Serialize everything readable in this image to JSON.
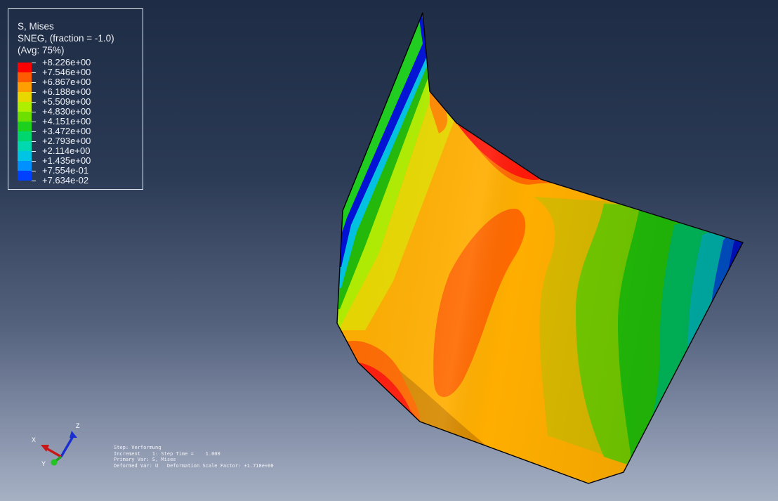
{
  "legend": {
    "title": "S, Mises",
    "subtitle": "SNEG, (fraction = -1.0)",
    "averaging": "(Avg: 75%)",
    "levels": [
      {
        "value": "+8.226e+00",
        "color": "#ff0000"
      },
      {
        "value": "+7.546e+00",
        "color": "#ff5a00"
      },
      {
        "value": "+6.867e+00",
        "color": "#ff9e00"
      },
      {
        "value": "+6.188e+00",
        "color": "#e8d800"
      },
      {
        "value": "+5.509e+00",
        "color": "#b0ee00"
      },
      {
        "value": "+4.830e+00",
        "color": "#6ee000"
      },
      {
        "value": "+4.151e+00",
        "color": "#1ed01e"
      },
      {
        "value": "+3.472e+00",
        "color": "#00d66e"
      },
      {
        "value": "+2.793e+00",
        "color": "#00d8b0"
      },
      {
        "value": "+2.114e+00",
        "color": "#00c4e4"
      },
      {
        "value": "+1.435e+00",
        "color": "#0090ff"
      },
      {
        "value": "+7.554e-01",
        "color": "#0040ff"
      },
      {
        "value": "+7.634e-02",
        "color": "#0000ff"
      }
    ]
  },
  "triad": {
    "x_label": "X",
    "y_label": "Y",
    "z_label": "Z"
  },
  "info": {
    "step": "Step: Verformung",
    "increment": "Increment    1: Step Time =    1.000",
    "primary_var": "Primary Var: S, Mises",
    "deformed_var": "Deformed Var: U   Deformation Scale Factor: +1.718e+00"
  },
  "contour_colors": {
    "red": "#ff1a0a",
    "orange_red": "#ff6a00",
    "orange": "#ffae00",
    "yellow_green": "#b6c800",
    "lime": "#72c800",
    "green": "#22bb08",
    "emerald": "#00b85a",
    "teal": "#00b0a8",
    "cyan": "#00b8d8",
    "blue": "#0050ff",
    "deep_blue": "#0010d8"
  }
}
